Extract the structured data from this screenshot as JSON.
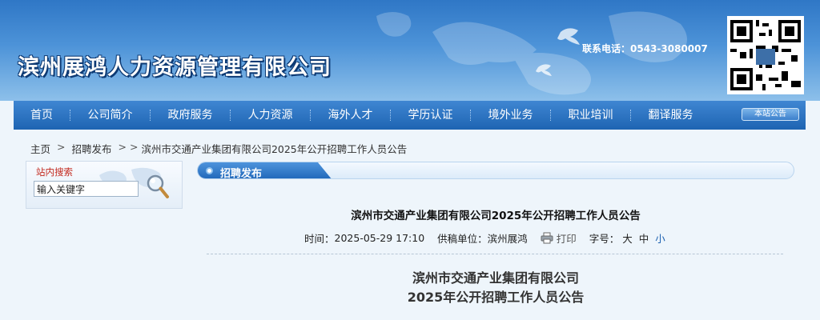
{
  "header": {
    "site_title": "滨州展鸿人力资源管理有限公司",
    "contact_label": "联系电话：",
    "contact_phone": "0543-3080007"
  },
  "nav": {
    "items": [
      {
        "label": "首页"
      },
      {
        "label": "公司简介"
      },
      {
        "label": "政府服务"
      },
      {
        "label": "人力资源"
      },
      {
        "label": "海外人才"
      },
      {
        "label": "学历认证"
      },
      {
        "label": "境外业务"
      },
      {
        "label": "职业培训"
      },
      {
        "label": "翻译服务"
      }
    ],
    "notice_button": "本站公告"
  },
  "breadcrumb": {
    "home": "主页",
    "sep1": ">",
    "section": "招聘发布",
    "sep2": "> >",
    "current": "滨州市交通产业集团有限公司2025年公开招聘工作人员公告"
  },
  "search": {
    "title": "站内搜索",
    "value": "输入关键字",
    "icon": "search-icon"
  },
  "section": {
    "title": "招聘发布"
  },
  "article": {
    "title": "滨州市交通产业集团有限公司2025年公开招聘工作人员公告",
    "time_label": "时间：",
    "time_value": "2025-05-29 17:10",
    "source_label": "供稿单位：",
    "source_value": "滨州展鸿",
    "print_label": "打印",
    "font_label": "字号：",
    "font_sizes": [
      "大",
      "中",
      "小"
    ],
    "heading_line1": "滨州市交通产业集团有限公司",
    "heading_line2": "2025年公开招聘工作人员公告"
  },
  "colors": {
    "nav_bg": "#1e64b2",
    "search_title": "#c2271c",
    "active_font_size": "#1a5fb0"
  }
}
